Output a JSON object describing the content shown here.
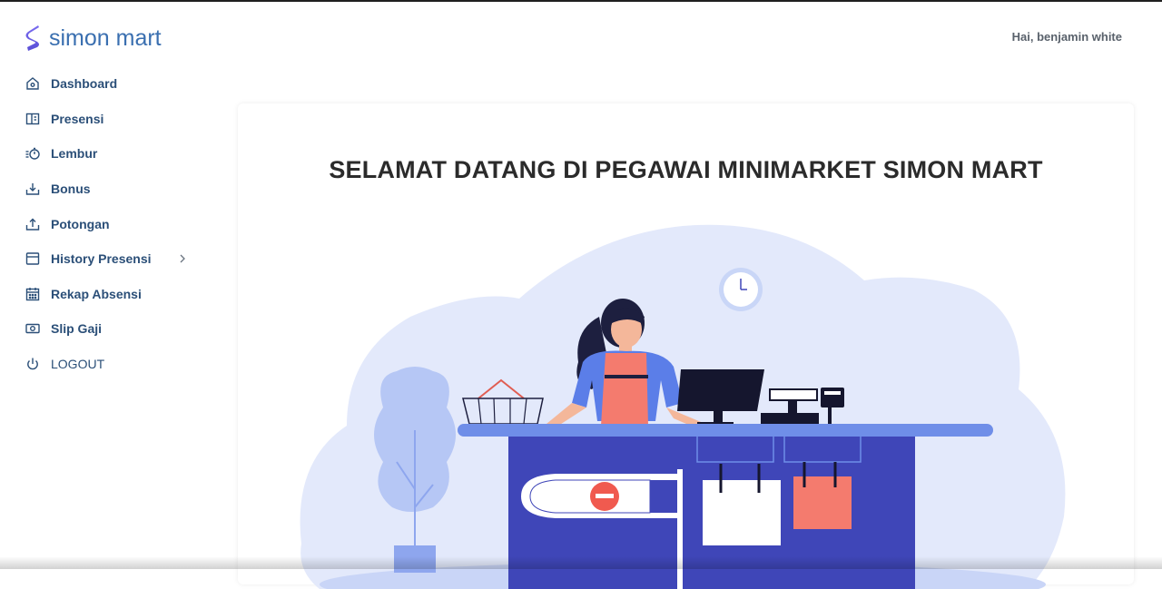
{
  "app": {
    "name": "simon mart"
  },
  "header": {
    "greeting": "Hai, benjamin white"
  },
  "sidebar": {
    "items": [
      {
        "label": "Dashboard",
        "icon": "home-icon"
      },
      {
        "label": "Presensi",
        "icon": "book-icon"
      },
      {
        "label": "Lembur",
        "icon": "stopwatch-icon"
      },
      {
        "label": "Bonus",
        "icon": "download-icon"
      },
      {
        "label": "Potongan",
        "icon": "upload-icon"
      },
      {
        "label": "History Presensi",
        "icon": "window-icon",
        "has_submenu": true
      },
      {
        "label": "Rekap Absensi",
        "icon": "calendar-icon"
      },
      {
        "label": "Slip Gaji",
        "icon": "money-icon"
      },
      {
        "label": "LOGOUT",
        "icon": "power-icon"
      }
    ]
  },
  "main": {
    "title": "SELAMAT DATANG DI PEGAWAI MINIMARKET SIMON MART"
  },
  "colors": {
    "brand": "#3a6fb0",
    "menu_text": "#2b4f78",
    "illustration_bg": "#e3e9fb",
    "counter": "#3f46b8",
    "apron": "#f47b6e"
  }
}
